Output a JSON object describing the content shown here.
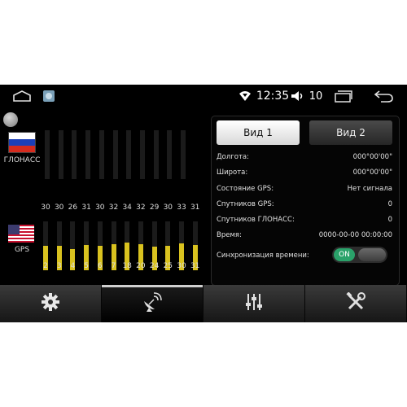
{
  "status_bar": {
    "time": "12:35",
    "volume": "10"
  },
  "satellites": {
    "glonass_label": "ГЛОНАСС",
    "gps_label": "GPS",
    "glonass_bars": 11,
    "gps": [
      {
        "prn": "2",
        "snr": "30",
        "level": 30
      },
      {
        "prn": "3",
        "snr": "30",
        "level": 30
      },
      {
        "prn": "4",
        "snr": "26",
        "level": 26
      },
      {
        "prn": "5",
        "snr": "31",
        "level": 31
      },
      {
        "prn": "6",
        "snr": "30",
        "level": 30
      },
      {
        "prn": "7",
        "snr": "32",
        "level": 32
      },
      {
        "prn": "18",
        "snr": "34",
        "level": 34
      },
      {
        "prn": "20",
        "snr": "32",
        "level": 32
      },
      {
        "prn": "24",
        "snr": "29",
        "level": 29
      },
      {
        "prn": "25",
        "snr": "30",
        "level": 30
      },
      {
        "prn": "30",
        "snr": "33",
        "level": 33
      },
      {
        "prn": "31",
        "snr": "31",
        "level": 31
      }
    ],
    "fill_color": "#d9c21f"
  },
  "info": {
    "tab1": "Вид 1",
    "tab2": "Вид 2",
    "rows": [
      {
        "label": "Долгота:",
        "value": "000°00'00\""
      },
      {
        "label": "Широта:",
        "value": "000°00'00\""
      },
      {
        "label": "Состояние GPS:",
        "value": "Нет сигнала"
      },
      {
        "label": "Спутников GPS:",
        "value": "0"
      },
      {
        "label": "Спутников ГЛОНАСС:",
        "value": "0"
      },
      {
        "label": "Время:",
        "value": "0000-00-00 00:00:00"
      }
    ],
    "sync_label": "Синхронизация времени:",
    "sync_state": "ON",
    "accent": "#2aa26a"
  },
  "bottom_bar": {
    "items": [
      {
        "icon": "gear-icon"
      },
      {
        "icon": "satellite-dish-icon"
      },
      {
        "icon": "equalizer-icon"
      },
      {
        "icon": "tools-icon"
      }
    ]
  }
}
